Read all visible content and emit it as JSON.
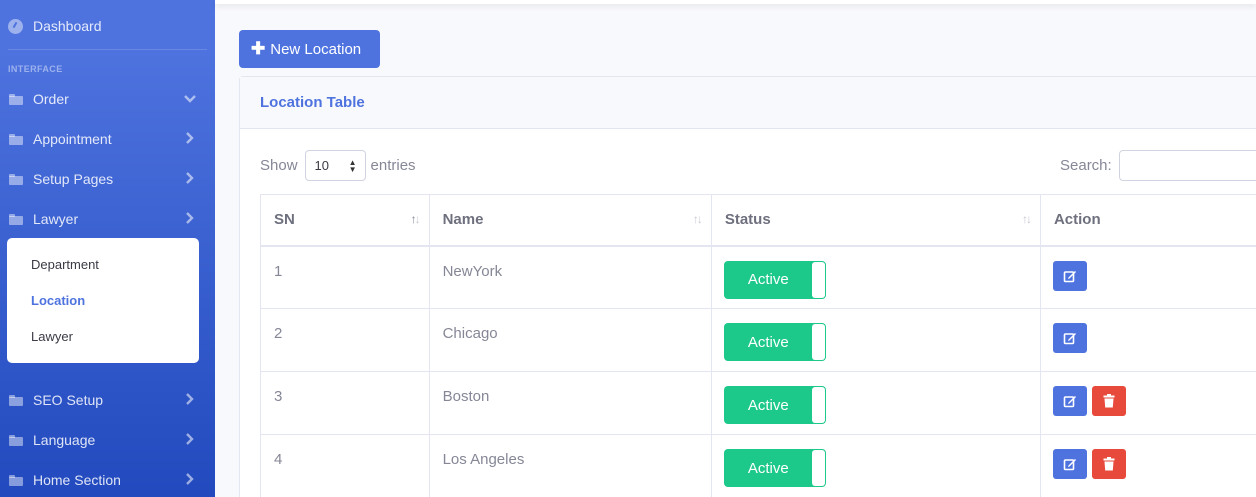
{
  "sidebar": {
    "dashboard": "Dashboard",
    "heading": "INTERFACE",
    "items": [
      {
        "label": "Order"
      },
      {
        "label": "Appointment"
      },
      {
        "label": "Setup Pages"
      },
      {
        "label": "Lawyer"
      },
      {
        "label": "SEO Setup"
      },
      {
        "label": "Language"
      },
      {
        "label": "Home Section"
      }
    ],
    "submenu": [
      {
        "label": "Department"
      },
      {
        "label": "Location"
      },
      {
        "label": "Lawyer"
      }
    ]
  },
  "toolbar": {
    "new_label": "New Location"
  },
  "card": {
    "title": "Location Table"
  },
  "length": {
    "show": "Show",
    "value": "10",
    "entries": "entries"
  },
  "search": {
    "label": "Search:"
  },
  "table": {
    "headers": [
      "SN",
      "Name",
      "Status",
      "Action"
    ],
    "rows": [
      {
        "sn": "1",
        "name": "NewYork",
        "status": "Active"
      },
      {
        "sn": "2",
        "name": "Chicago",
        "status": "Active"
      },
      {
        "sn": "3",
        "name": "Boston",
        "status": "Active"
      },
      {
        "sn": "4",
        "name": "Los Angeles",
        "status": "Active"
      }
    ]
  },
  "colors": {
    "primary": "#4e73df",
    "success": "#1cc88a",
    "danger": "#e74a3b"
  },
  "icons": [
    "dashboard-gauge-icon",
    "folder-icon",
    "chevron-right-icon",
    "chevron-down-icon",
    "plus-icon",
    "sort-icon",
    "edit-icon",
    "trash-icon"
  ]
}
